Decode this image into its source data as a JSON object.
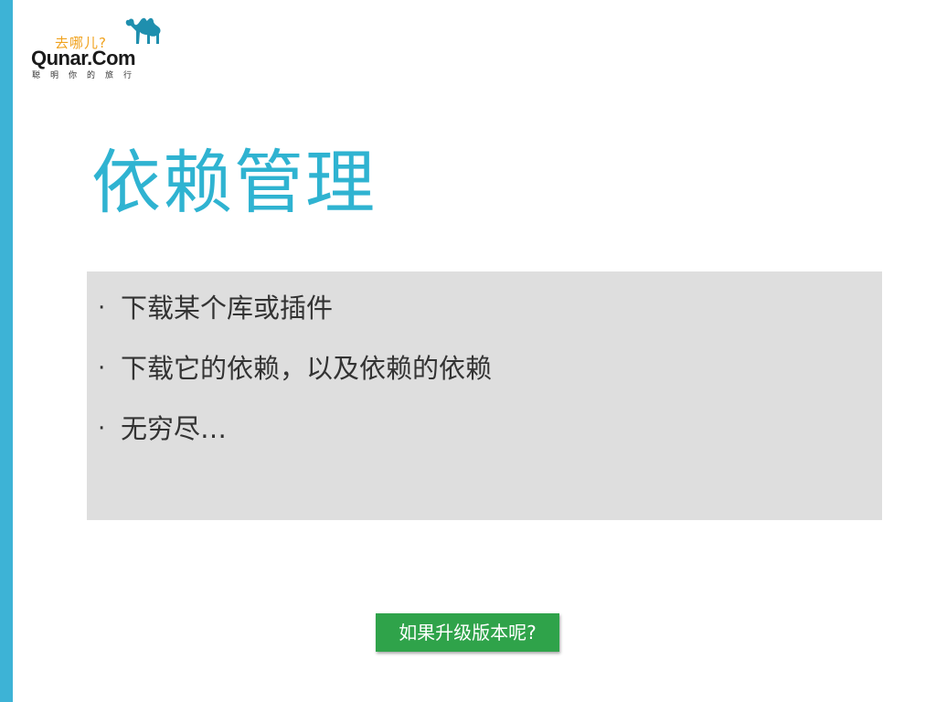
{
  "logo": {
    "cn_text": "去哪儿?",
    "en_text": "Qunar.Com",
    "tagline": "聪明你的旅行"
  },
  "slide": {
    "title": "依赖管理",
    "bullets": [
      {
        "dot": "·",
        "text": "下载某个库或插件"
      },
      {
        "dot": "·",
        "text": "下载它的依赖，以及依赖的依赖"
      },
      {
        "dot": "·",
        "text": "无穷尽…"
      }
    ],
    "cta_label": "如果升级版本呢?"
  },
  "colors": {
    "accent_bar": "#3db3d6",
    "title": "#2fb3d1",
    "content_box": "#dedede",
    "cta_button": "#2fa34a",
    "logo_cn": "#f0a21e",
    "camel": "#1f8fae"
  },
  "icons": {
    "logo_mascot": "camel-icon"
  }
}
